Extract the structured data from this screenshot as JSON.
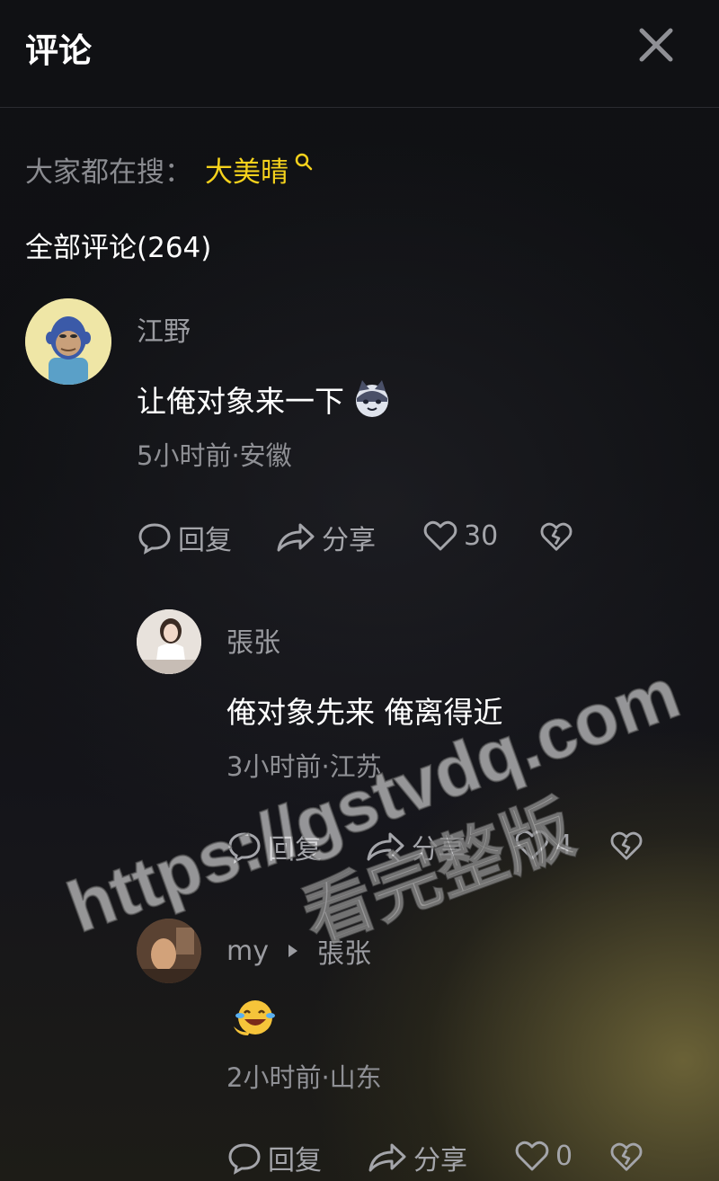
{
  "header": {
    "title": "评论",
    "close_icon": "close-icon"
  },
  "search": {
    "prefix": "大家都在搜：",
    "term": "大美晴"
  },
  "comments_section": {
    "title": "全部评论(264)"
  },
  "comments": [
    {
      "user": "江野",
      "text": "让俺对象来一下 ",
      "meta": "5小时前·安徽",
      "reply_label": "回复",
      "share_label": "分享",
      "likes": "30"
    },
    {
      "user": "張张",
      "text": "俺对象先来 俺离得近",
      "meta": "3小时前·江苏",
      "reply_label": "回复",
      "share_label": "分享",
      "likes": "4"
    },
    {
      "user": "my",
      "reply_to": "張张",
      "text": "",
      "meta": "2小时前·山东",
      "reply_label": "回复",
      "share_label": "分享",
      "likes": "0"
    }
  ],
  "watermark": {
    "line1": "https://gstvdq.com",
    "line2": "看完整版"
  },
  "colors": {
    "accent": "#f5d21c",
    "background": "#0d0e12"
  }
}
